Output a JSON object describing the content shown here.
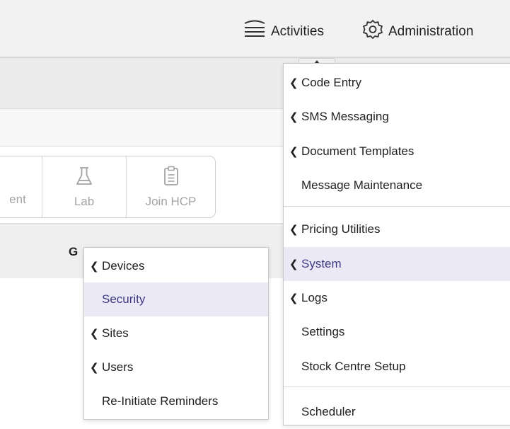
{
  "topbar": {
    "activities_label": "Activities",
    "administration_label": "Administration",
    "activities_icon": "list-lines-icon",
    "administration_icon": "gear-icon"
  },
  "toolbar": {
    "buttons": [
      {
        "label": "ent",
        "icon": "none"
      },
      {
        "label": "Lab",
        "icon": "flask-icon"
      },
      {
        "label": "Join HCP",
        "icon": "clipboard-icon"
      }
    ]
  },
  "table": {
    "header_partial": "G"
  },
  "admin_menu": {
    "items": [
      {
        "label": "Code Entry",
        "submenu": true
      },
      {
        "label": "SMS Messaging",
        "submenu": true
      },
      {
        "label": "Document Templates",
        "submenu": true
      },
      {
        "label": "Message Maintenance",
        "submenu": false
      },
      {
        "label": "Pricing Utilities",
        "submenu": true
      },
      {
        "label": "System",
        "submenu": true,
        "active": true
      },
      {
        "label": "Logs",
        "submenu": true
      },
      {
        "label": "Settings",
        "submenu": false
      },
      {
        "label": "Stock Centre Setup",
        "submenu": false
      },
      {
        "label": "Scheduler",
        "submenu": false
      }
    ]
  },
  "system_submenu": {
    "items": [
      {
        "label": "Devices",
        "submenu": true
      },
      {
        "label": "Security",
        "submenu": false,
        "active": true
      },
      {
        "label": "Sites",
        "submenu": true
      },
      {
        "label": "Users",
        "submenu": true
      },
      {
        "label": "Re-Initiate Reminders",
        "submenu": false
      }
    ]
  },
  "colors": {
    "active_bg": "#ebe9f6",
    "active_text": "#3d3a83",
    "topbar_bg": "#f2f2f2"
  }
}
